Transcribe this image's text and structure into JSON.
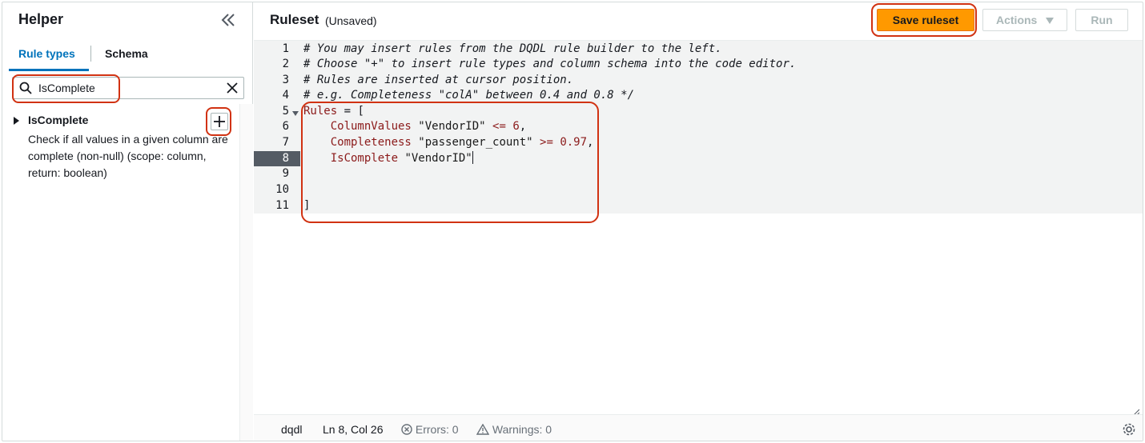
{
  "helper": {
    "title": "Helper",
    "tabs": [
      {
        "label": "Rule types",
        "active": true
      },
      {
        "label": "Schema",
        "active": false
      }
    ],
    "search": {
      "value": "IsComplete",
      "placeholder": ""
    },
    "items": [
      {
        "name": "IsComplete",
        "description": "Check if all values in a given column are complete (non-null) (scope: column, return: boolean)"
      }
    ]
  },
  "ruleset": {
    "title": "Ruleset",
    "status": "(Unsaved)",
    "buttons": {
      "save": "Save ruleset",
      "actions": "Actions",
      "run": "Run"
    },
    "line_numbers": [
      "1",
      "2",
      "3",
      "4",
      "5",
      "6",
      "7",
      "8",
      "9",
      "10",
      "11"
    ],
    "active_line": "8",
    "code": {
      "l1": "# You may insert rules from the DQDL rule builder to the left.",
      "l2": "# Choose \"+\" to insert rule types and column schema into the code editor.",
      "l3": "# Rules are inserted at cursor position.",
      "l4": "# e.g. Completeness \"colA\" between 0.4 and 0.8 */",
      "l5_kw": "Rules",
      "l5_rest": " = [",
      "l6_rule": "    ColumnValues ",
      "l6_str": "\"VendorID\"",
      "l6_op": " <= ",
      "l6_num": "6",
      "l6_end": ",",
      "l7_rule": "    Completeness ",
      "l7_str": "\"passenger_count\"",
      "l7_op": " >= ",
      "l7_num": "0.97",
      "l7_end": ",",
      "l8_rule": "    IsComplete ",
      "l8_str": "\"VendorID\"",
      "l11": "]"
    },
    "status_bar": {
      "language": "dqdl",
      "position": "Ln 8, Col 26",
      "errors": "Errors: 0",
      "warnings": "Warnings: 0"
    }
  },
  "colors": {
    "accent": "#0073bb",
    "primary_button": "#ff9900",
    "highlight": "#d13212"
  }
}
